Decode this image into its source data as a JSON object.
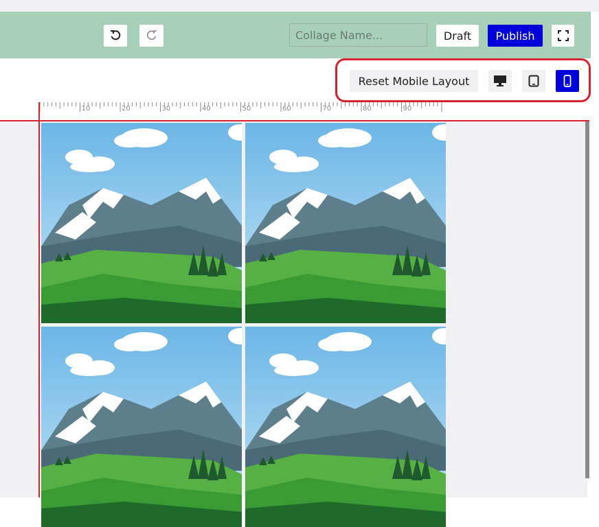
{
  "toolbar": {
    "undo_icon": "undo-icon",
    "redo_icon": "redo-icon",
    "collage_name": {
      "value": "",
      "placeholder": "Collage Name..."
    },
    "draft_label": "Draft",
    "publish_label": "Publish",
    "fullscreen_icon": "fullscreen-icon"
  },
  "layout_bar": {
    "reset_label": "Reset Mobile Layout",
    "devices": [
      {
        "name": "desktop",
        "icon": "desktop-icon",
        "active": false
      },
      {
        "name": "tablet",
        "icon": "tablet-icon",
        "active": false
      },
      {
        "name": "mobile",
        "icon": "mobile-icon",
        "active": true
      }
    ]
  },
  "ruler": {
    "labels": [
      "10",
      "20",
      "30",
      "40",
      "50",
      "60",
      "70",
      "80",
      "90"
    ]
  },
  "tiles": [
    {
      "image": "mountain-landscape"
    },
    {
      "image": "mountain-landscape"
    },
    {
      "image": "mountain-landscape"
    },
    {
      "image": "mountain-landscape"
    }
  ],
  "colors": {
    "toolbar_bg": "#a8d0b8",
    "accent": "#0000dd",
    "highlight": "#d8222f",
    "canvas_bg": "#f1f1f3"
  }
}
